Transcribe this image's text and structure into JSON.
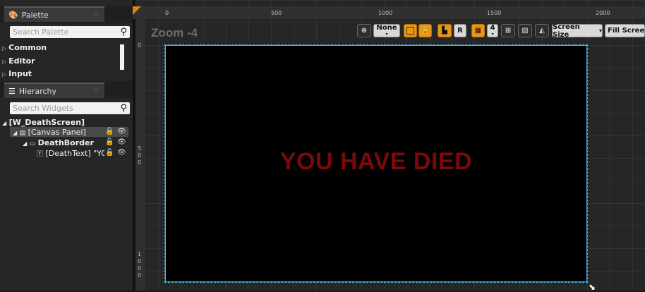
{
  "palette": {
    "tab_label": "Palette",
    "tab_icon": "palette-icon",
    "close": "×",
    "search_placeholder": "Search Palette",
    "categories": [
      "Common",
      "Editor",
      "Input"
    ]
  },
  "hierarchy": {
    "tab_label": "Hierarchy",
    "tab_icon": "hierarchy-icon",
    "close": "×",
    "search_placeholder": "Search Widgets",
    "items": [
      {
        "label": "[W_DeathScreen]"
      },
      {
        "label": "[Canvas Panel]"
      },
      {
        "label": "DeathBorder"
      },
      {
        "label": "[DeathText] \"YO"
      }
    ]
  },
  "ruler": {
    "top": [
      "0",
      "500",
      "1000",
      "1500",
      "2000"
    ],
    "left": [
      "0",
      "5",
      "0",
      "0",
      "1",
      "0",
      "0",
      "0"
    ]
  },
  "designer": {
    "zoom_label": "Zoom -4",
    "toolbar": {
      "none_label": "None",
      "r_label": "R",
      "grid_size": "4",
      "screen_size_label": "Screen Size",
      "fill_screen_label": "Fill Screen"
    },
    "canvas_text": "YOU HAVE DIED",
    "colors": {
      "selection": "#3fb6e6",
      "death_text": "#7a0a0a",
      "accent": "#e8961a"
    }
  }
}
